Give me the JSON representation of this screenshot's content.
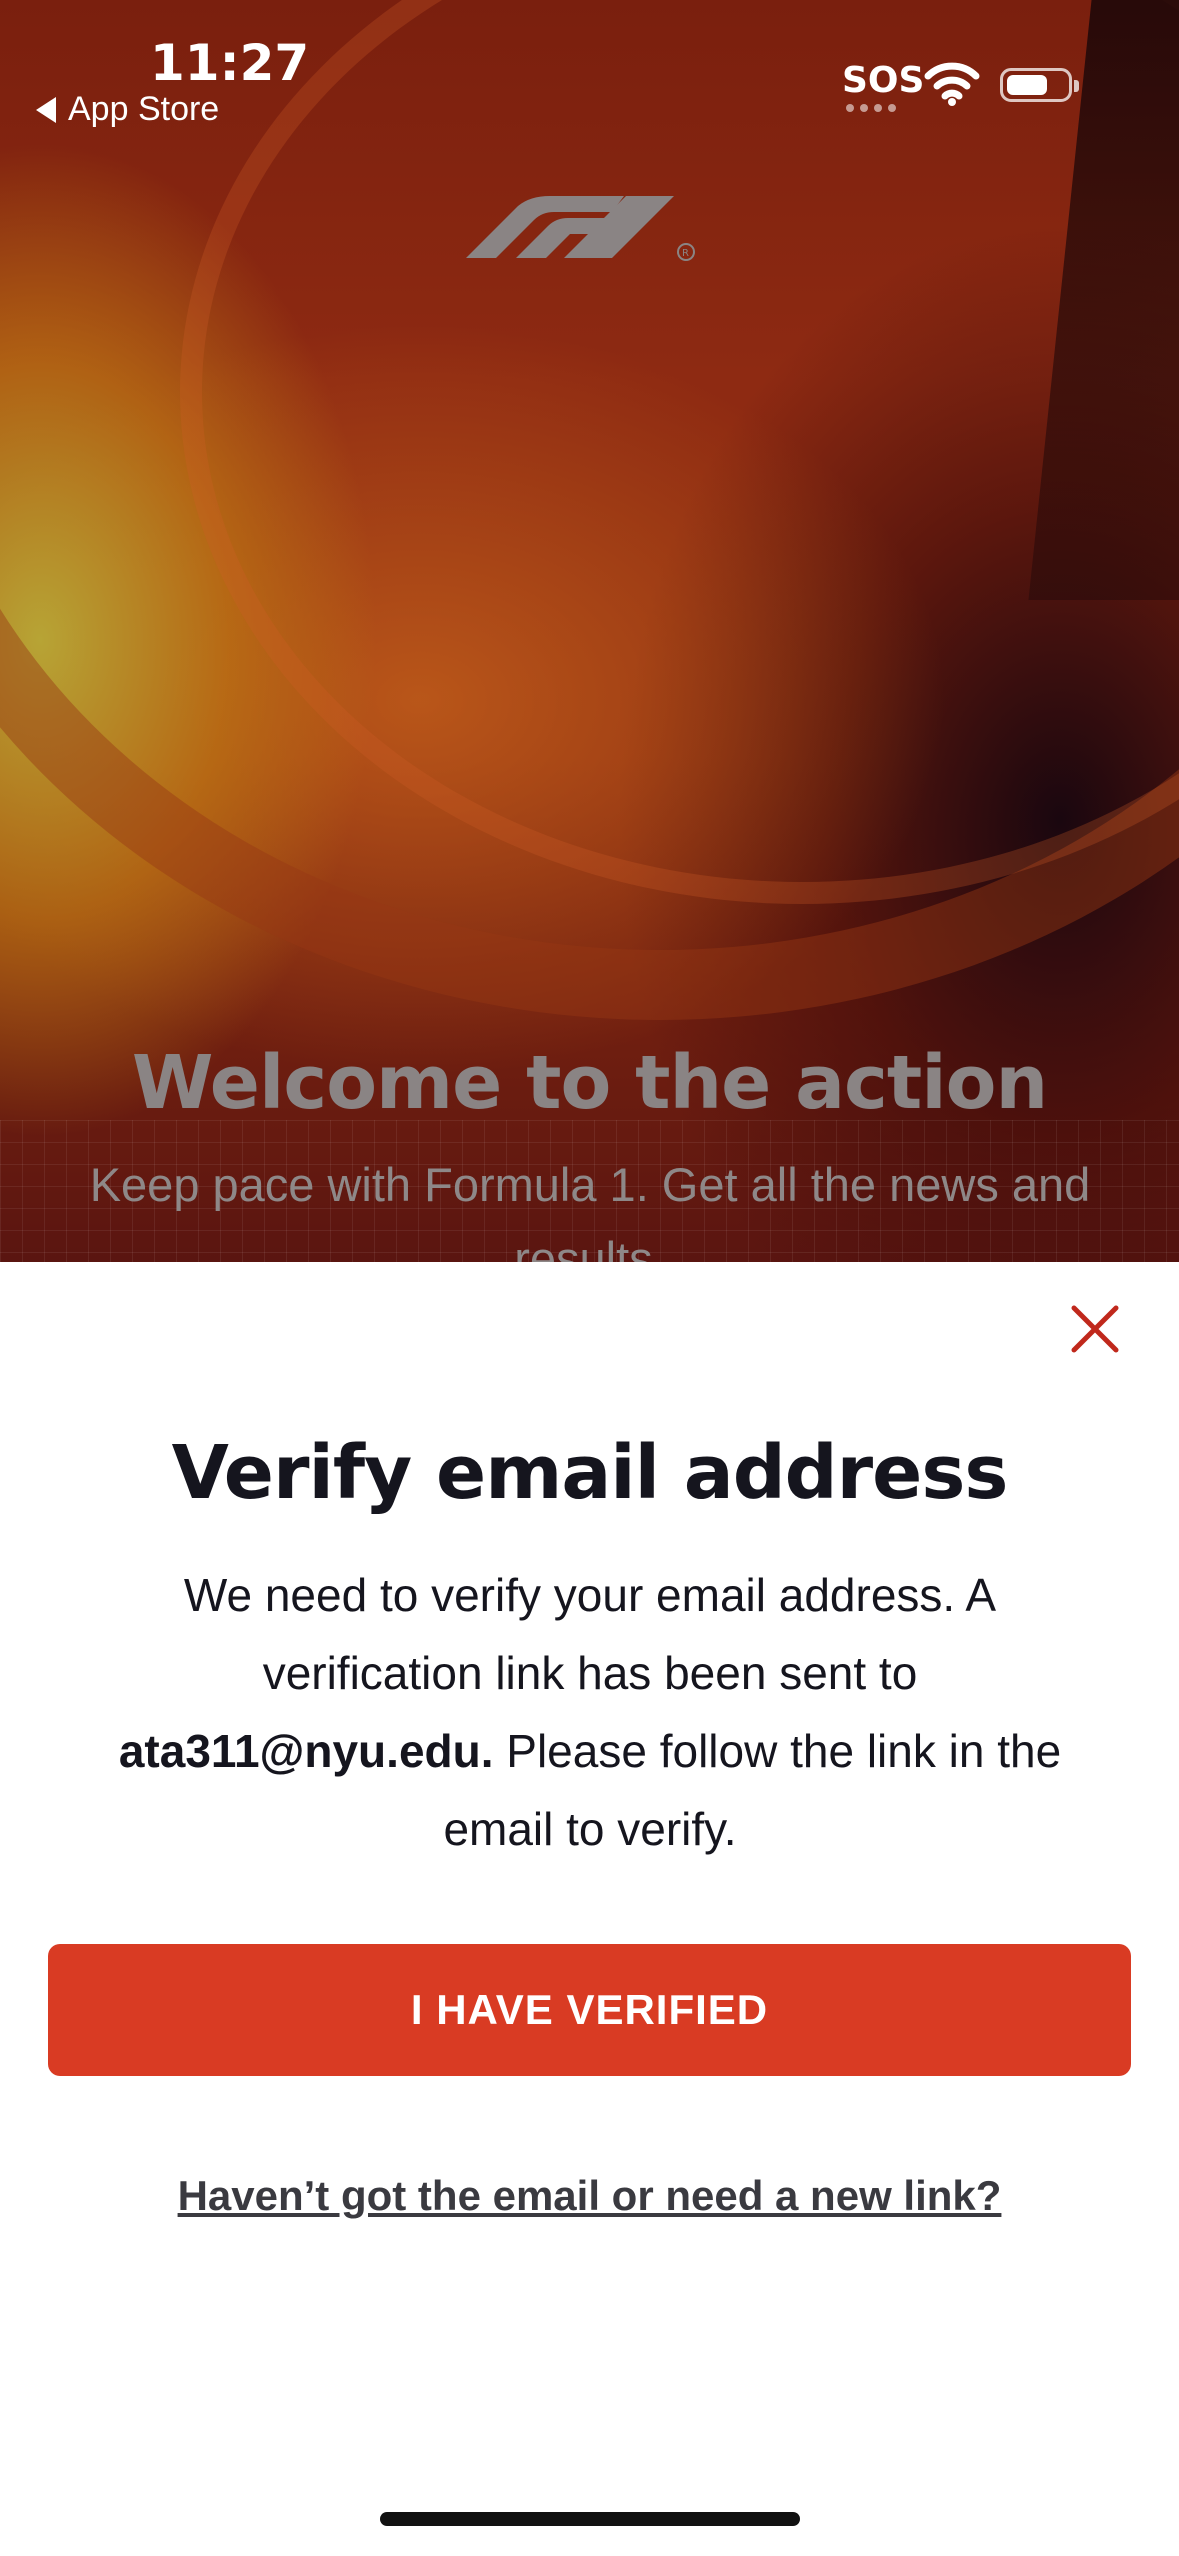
{
  "status_bar": {
    "time": "11:27",
    "back_label": "App Store",
    "sos": "SOS"
  },
  "hero": {
    "title": "Welcome to the action",
    "subtitle": "Keep pace with Formula 1. Get all the news and results."
  },
  "dialog": {
    "title": "Verify email address",
    "body_before": "We need to verify your email address. A verification link has been sent to ",
    "email": "ata311@nyu.edu.",
    "body_after": " Please follow the link in the email to verify.",
    "primary_button": "I HAVE VERIFIED",
    "secondary_link": "Haven’t got the email or need a new link?"
  },
  "colors": {
    "accent": "#d93b23",
    "close_icon": "#c0281c",
    "text_dark": "#15151e"
  },
  "icons": {
    "close": "close-icon",
    "back": "back-arrow-icon",
    "wifi": "wifi-icon",
    "battery": "battery-icon",
    "logo": "f1-logo"
  }
}
